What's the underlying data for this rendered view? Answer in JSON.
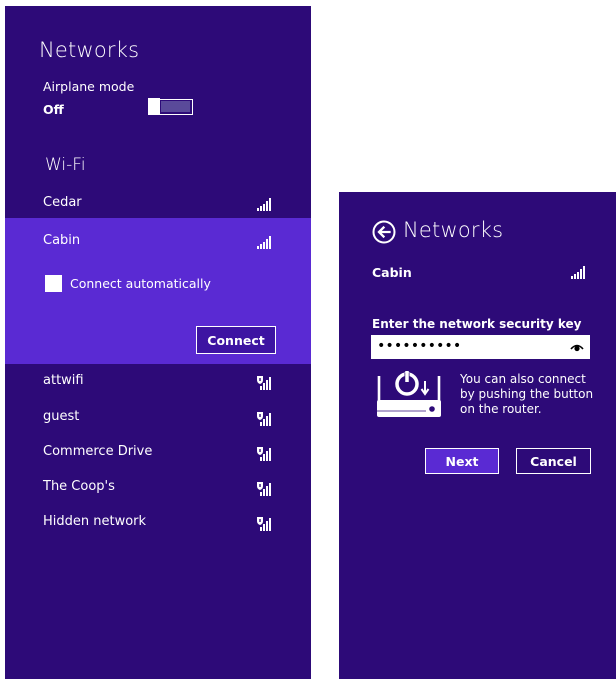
{
  "left": {
    "title": "Networks",
    "airplane_label": "Airplane mode",
    "airplane_state": "Off",
    "wifi_heading": "Wi-Fi",
    "networks": [
      {
        "name": "Cedar",
        "secured": false
      },
      {
        "name": "Cabin",
        "secured": false,
        "selected": true
      },
      {
        "name": "attwifi",
        "secured": true
      },
      {
        "name": "guest",
        "secured": true
      },
      {
        "name": "Commerce Drive",
        "secured": true
      },
      {
        "name": "The Coop's",
        "secured": true
      },
      {
        "name": "Hidden network",
        "secured": true
      }
    ],
    "connect_auto_label": "Connect automatically",
    "connect_button": "Connect"
  },
  "right": {
    "title": "Networks",
    "network_name": "Cabin",
    "key_label": "Enter the network security key",
    "key_value": "••••••••••",
    "wps_hint_line1": "You can also connect",
    "wps_hint_line2": "by pushing the button",
    "wps_hint_line3": "on the router.",
    "next_button": "Next",
    "cancel_button": "Cancel"
  },
  "colors": {
    "panel_bg": "#2d0a78",
    "selected_bg": "#5a2ad3",
    "text": "#ffffff"
  },
  "icons": [
    "wifi-signal-icon",
    "secured-wifi-signal-icon",
    "back-arrow-icon",
    "reveal-password-icon",
    "router-wps-icon"
  ]
}
